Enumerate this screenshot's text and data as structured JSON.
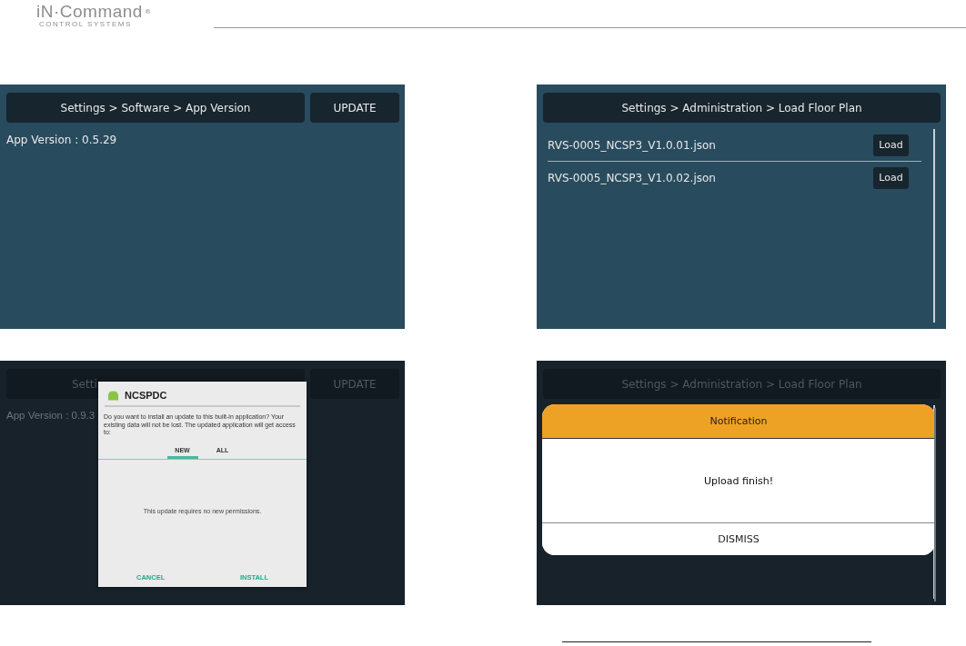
{
  "header": {
    "logo": {
      "name": "iN·Command",
      "mark": "®",
      "tagline": "CONTROL SYSTEMS"
    }
  },
  "screens": [
    {
      "kind": "version",
      "dimmed": false,
      "breadcrumb": "Settings > Software > App Version",
      "button": "UPDATE",
      "info": "App Version : 0.5.29"
    },
    {
      "kind": "files",
      "dimmed": false,
      "breadcrumb": "Settings > Administration > Load Floor Plan",
      "files": [
        {
          "name": "RVS-0005_NCSP3_V1.0.01.json",
          "button": "Load"
        },
        {
          "name": "RVS-0005_NCSP3_V1.0.02.json",
          "button": "Load"
        }
      ]
    },
    {
      "kind": "version",
      "dimmed": true,
      "breadcrumb": "Setti",
      "button": "UPDATE",
      "info": "App Version : 0.9.3",
      "dialog": {
        "kind": "install",
        "title": "NCSPDC",
        "question": "Do you want to install an update to this built-in application? Your existing data will not be lost. The updated application will get access to:",
        "tabs": [
          {
            "label": "NEW",
            "selected": true
          },
          {
            "label": "ALL",
            "selected": false
          }
        ],
        "message": "This update requires no new permissions.",
        "buttons": [
          "CANCEL",
          "INSTALL"
        ]
      }
    },
    {
      "kind": "files",
      "dimmed": true,
      "breadcrumb": "Settings > Administration > Load Floor Plan",
      "dialog": {
        "kind": "notification",
        "title": "Notification",
        "message": "Upload finish!",
        "button": "DISMISS"
      }
    }
  ]
}
